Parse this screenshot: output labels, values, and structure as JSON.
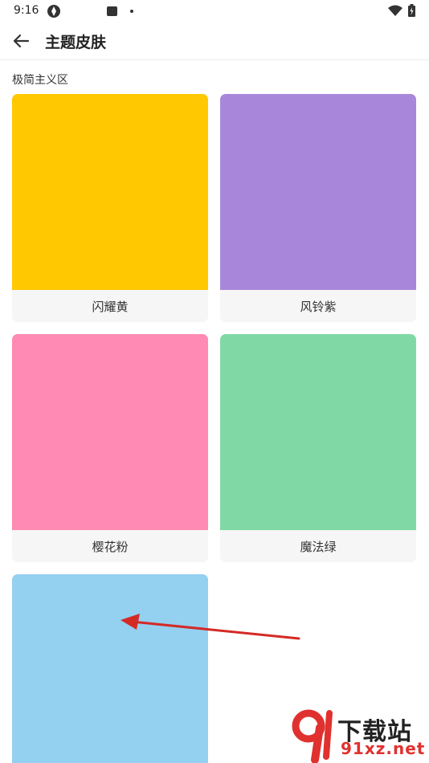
{
  "status_bar": {
    "time": "9:16"
  },
  "app_bar": {
    "title": "主题皮肤"
  },
  "section": {
    "title": "极简主义区"
  },
  "themes": [
    {
      "label": "闪耀黄",
      "color": "#FFC800"
    },
    {
      "label": "风铃紫",
      "color": "#A887DB"
    },
    {
      "label": "樱花粉",
      "color": "#FF8AB3"
    },
    {
      "label": "魔法绿",
      "color": "#80D9A5"
    },
    {
      "label": "",
      "color": "#94D0F0"
    }
  ],
  "watermark": {
    "text_main": "下载站",
    "text_url": "91xz.net"
  }
}
